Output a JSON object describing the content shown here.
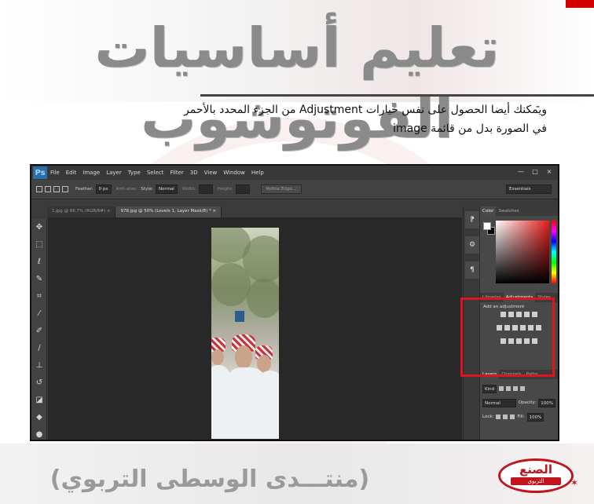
{
  "header": {
    "title": "تعليم أساسيات الفوتوشوب"
  },
  "instruction": {
    "dash": "-",
    "line1": "ويمكنك أيضا الحصول على نفس خيارات Adjustment من الجزء المحدد بالأحمر",
    "line2": "في الصورة بدل من قائمة image"
  },
  "photoshop": {
    "logo": "Ps",
    "menu": [
      "File",
      "Edit",
      "Image",
      "Layer",
      "Type",
      "Select",
      "Filter",
      "3D",
      "View",
      "Window",
      "Help"
    ],
    "window_controls": [
      "—",
      "□",
      "×"
    ],
    "options": {
      "feather_label": "Feather:",
      "feather_value": "0 px",
      "antialias_label": "Anti-alias",
      "style_label": "Style:",
      "style_value": "Normal",
      "width_label": "Width:",
      "height_label": "Height:",
      "refine_edge": "Refine Edge...",
      "workspace": "Essentials"
    },
    "tabs": [
      {
        "label": "1.jpg @ 66.7% (RGB/8#)",
        "close": "×"
      },
      {
        "label": "978.jpg @ 50% (Levels 1, Layer Mask/8) *",
        "close": "×"
      }
    ],
    "panels": {
      "color_tabs": [
        "Color",
        "Swatches"
      ],
      "adj_tabs": [
        "Libraries",
        "Adjustments",
        "Styles"
      ],
      "adj_title": "Add an adjustment",
      "layers_tabs": [
        "Layers",
        "Channels",
        "Paths"
      ],
      "kind_label": "Kind",
      "blend_mode": "Normal",
      "opacity_label": "Opacity:",
      "opacity_value": "100%",
      "lock_label": "Lock:",
      "fill_label": "Fill:",
      "fill_value": "100%"
    }
  },
  "footer": {
    "forum_name": "(منتـــدى الوسطى التربوي)",
    "logo_text": "الصنع",
    "logo_sub": "التربوي"
  },
  "colors": {
    "accent_red": "#e0141e",
    "ps_bg": "#3b3b3b"
  }
}
